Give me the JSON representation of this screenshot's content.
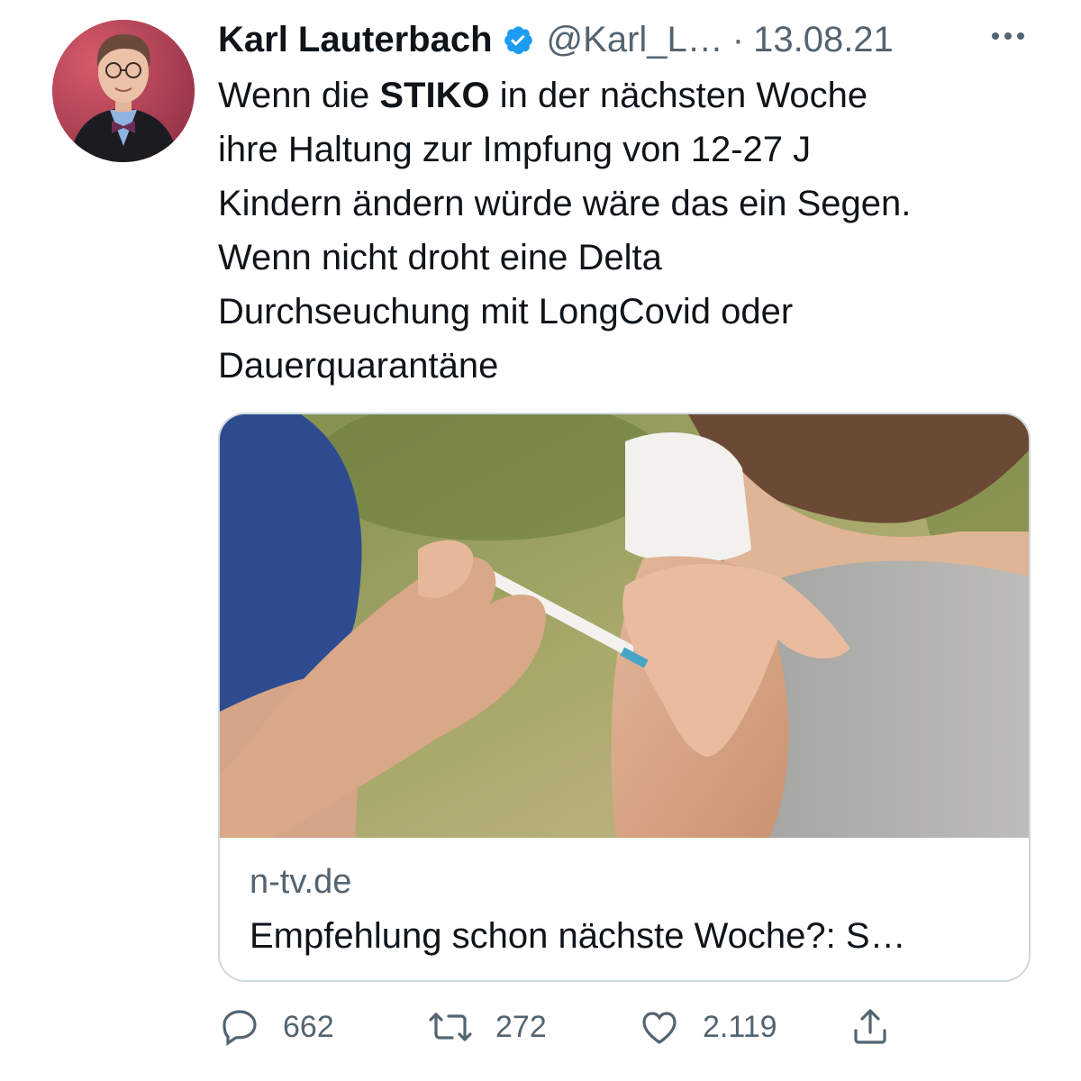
{
  "tweet": {
    "author_name": "Karl Lauterbach",
    "handle": "@Karl_L…",
    "separator": "·",
    "date": "13.08.21",
    "text_lines": [
      {
        "pre": "Wenn die ",
        "bold": "STIKO",
        "post": " in der nächsten Woche"
      },
      {
        "pre": "ihre Haltung zur Impfung von 12-27 J",
        "bold": "",
        "post": ""
      },
      {
        "pre": "Kindern ändern würde wäre das ein Segen.",
        "bold": "",
        "post": ""
      },
      {
        "pre": "Wenn nicht droht eine Delta",
        "bold": "",
        "post": ""
      },
      {
        "pre": "Durchseuchung mit LongCovid oder",
        "bold": "",
        "post": ""
      },
      {
        "pre": "Dauerquarantäne",
        "bold": "",
        "post": ""
      }
    ]
  },
  "card": {
    "domain": "n-tv.de",
    "title": "Empfehlung schon nächste Woche?: S…"
  },
  "actions": {
    "replies": "662",
    "retweets": "272",
    "likes": "2.119"
  },
  "colors": {
    "text": "#0f1419",
    "secondary": "#536471",
    "verified": "#1d9bf0",
    "border": "#cfd9de"
  },
  "icons": [
    "verified-badge-icon",
    "more-icon",
    "reply-icon",
    "retweet-icon",
    "like-icon",
    "share-icon"
  ]
}
